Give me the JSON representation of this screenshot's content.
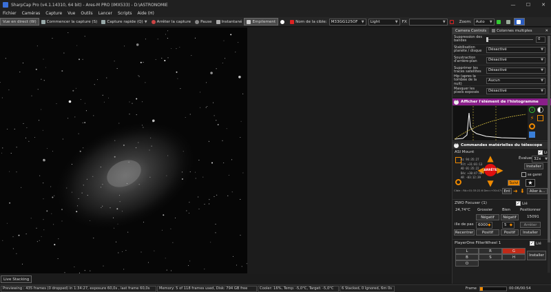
{
  "window": {
    "title": "SharpCap Pro (v4.1.14310, 64 bit) - Ares-M PRO (IMX533) - D:\\ASTRONOMIE",
    "minimize": "—",
    "maximize": "☐",
    "close": "✕"
  },
  "menu": [
    "Fichier",
    "Caméras",
    "Capture",
    "Vue",
    "Outils",
    "Lancer",
    "Scripts",
    "Aide (H)"
  ],
  "toolbar": {
    "live_view": "Vue en direct (W)",
    "start_capture": "Commencer la capture (S)",
    "quick_capture": "Capture rapide (Q)",
    "stop_capture": "Arrêter la capture",
    "pause": "Pause",
    "snapshot": "Instantané",
    "stacking": "Empilement",
    "target_label": "Nom de la cible:",
    "target_value": "M33GG125OF",
    "frame_type": "Light",
    "fx_label": "FX",
    "fx_value": "",
    "zoom_label": "Zoom:",
    "zoom_value": "Auto"
  },
  "panel": {
    "tabs": [
      "Camera Controls",
      "Colonnes multiples"
    ],
    "settings": [
      {
        "label": "Suppression des bandes",
        "value": "0",
        "type": "slider"
      },
      {
        "label": "Stabilisation planète / disque",
        "value": "Désactivé",
        "type": "select"
      },
      {
        "label": "Soustraction d'arrière-plan",
        "value": "Désactivé",
        "type": "select"
      },
      {
        "label": "Supprimer les traces satellites",
        "value": "Désactivé",
        "type": "select"
      },
      {
        "label": "Hip (apres la tombée de la nuit)",
        "value": "Aucun",
        "type": "select"
      },
      {
        "label": "Masquer les pixels exposés",
        "value": "Désactivé",
        "type": "select"
      }
    ],
    "histogram_title": "Afficher l'élément de l'histogramme",
    "telescope_title": "Commandes matérielles du télescope",
    "mount": {
      "name": "ASI Mount",
      "link": "Lié",
      "speed_label": "Évaluer:",
      "speed_value": "32x",
      "install": "Installer",
      "stop": "ARRÊTE",
      "follow": "Suivi",
      "goto_label": "se garer",
      "coords": [
        {
          "k": "Az",
          "v": "94:35:27"
        },
        {
          "k": "Alt",
          "v": "+31:01:13"
        },
        {
          "k": "AD",
          "v": "01:35:22"
        },
        {
          "k": "Déc",
          "v": "+30:47:48"
        },
        {
          "k": "AR",
          "v": "-03:12:39"
        }
      ],
      "target_line": "Cible : RA=01:33:22.6 Dec=+30:47:47",
      "ent": "Ent",
      "goto": "Aller à..."
    },
    "focuser": {
      "name": "ZWO Focuser (1)",
      "link": "Lié",
      "temp": "24,74°C",
      "coarse": "Grossier",
      "fine": "Bien",
      "position_label": "Positionner",
      "neg1": "Négatif",
      "neg2": "Négatif",
      "position": "15091",
      "step_label": "ille de pas",
      "step": "6000",
      "step2": "5",
      "stop": "Arrêter",
      "recenter": "Recentrer",
      "pos1": "Positif",
      "pos2": "Positif",
      "install": "Installer"
    },
    "filter_wheel": {
      "name": "PlayerOne FilterWheel 1",
      "link": "Lié",
      "slots": [
        "L",
        "R",
        "G",
        "B",
        "S",
        "H",
        "O"
      ],
      "active": "G",
      "install": "Installer"
    }
  },
  "live_stacking": "Live Stacking",
  "status": {
    "previewing": "Previewing : 435 frames (0 dropped) in 1:34:27, exposure 60,0s , last frame 60,0s",
    "memory": "Memory: 5 of 118 frames used, Disk: 794 GB free",
    "cooler": "Cooler: 16%, Temp: -5,0°C, Target: -5,0°C",
    "stacked": "6 Stacked, 0 Ignored, 6m 0s",
    "frame_label": "Frame",
    "frame_time": "00:06/00:54",
    "frame_progress": 0.1
  },
  "colors": {
    "accent_blue": "#3a6fd8",
    "histogram_header": "#8a1f8a",
    "orange": "#f08a00",
    "stop_red": "#e01010",
    "filter_active": "#c02a18"
  }
}
